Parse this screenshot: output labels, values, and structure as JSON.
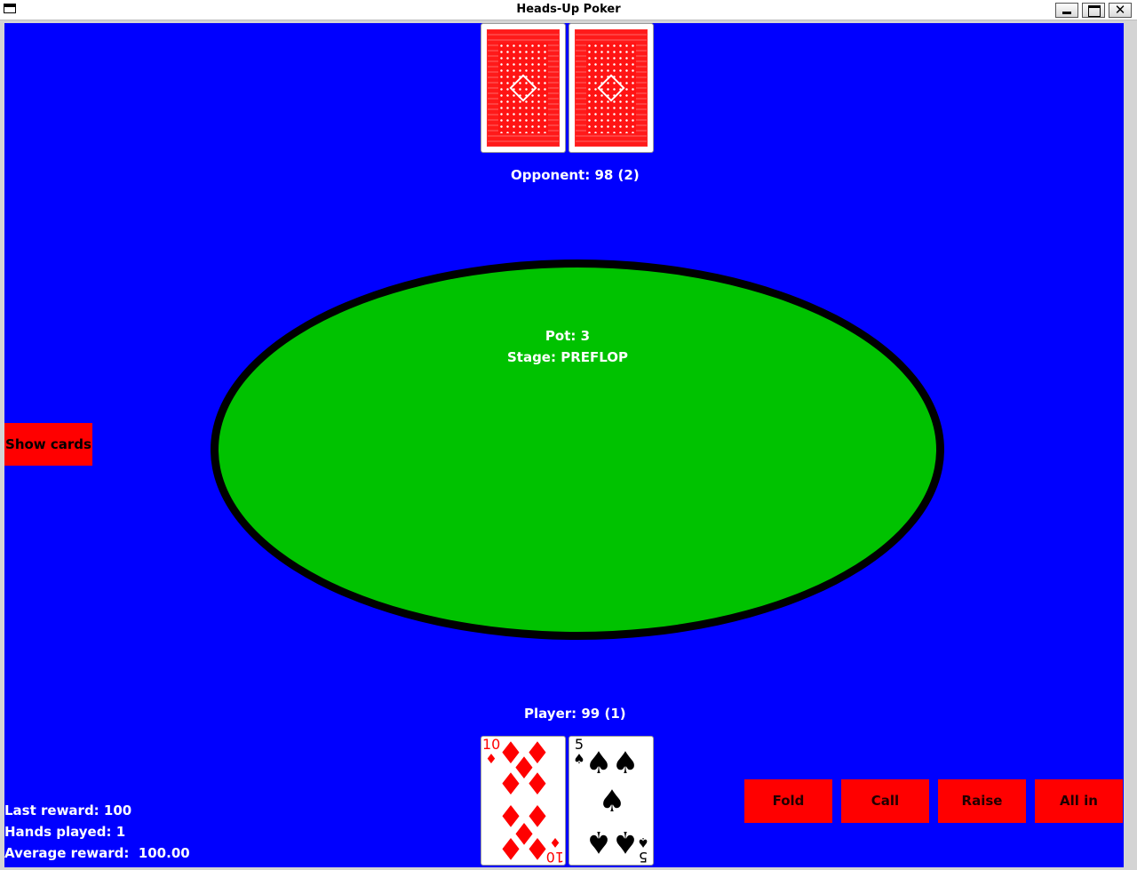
{
  "window": {
    "title": "Heads-Up Poker",
    "buttons": {
      "minimize_icon": "minimize-icon",
      "maximize_icon": "maximize-icon",
      "close": "✕"
    }
  },
  "colors": {
    "table": "#0000ff",
    "felt": "#00c200",
    "buttons": "#ff0000",
    "text": "#ffffff"
  },
  "opponent": {
    "label": "Opponent: 98 (2)",
    "cards": [
      "face-down",
      "face-down"
    ]
  },
  "board": {
    "pot": "Pot: 3",
    "stage": "Stage: PREFLOP"
  },
  "player": {
    "label": "Player: 99 (1)",
    "cards": [
      {
        "rank": "10",
        "suit": "♦",
        "color": "red"
      },
      {
        "rank": "5",
        "suit": "♠",
        "color": "black"
      }
    ]
  },
  "controls": {
    "show_cards": "Show cards",
    "actions": [
      "Fold",
      "Call",
      "Raise",
      "All in"
    ]
  },
  "stats": {
    "last_reward": "Last reward: 100",
    "hands_played": "Hands played: 1",
    "average_reward": "Average reward:  100.00"
  }
}
